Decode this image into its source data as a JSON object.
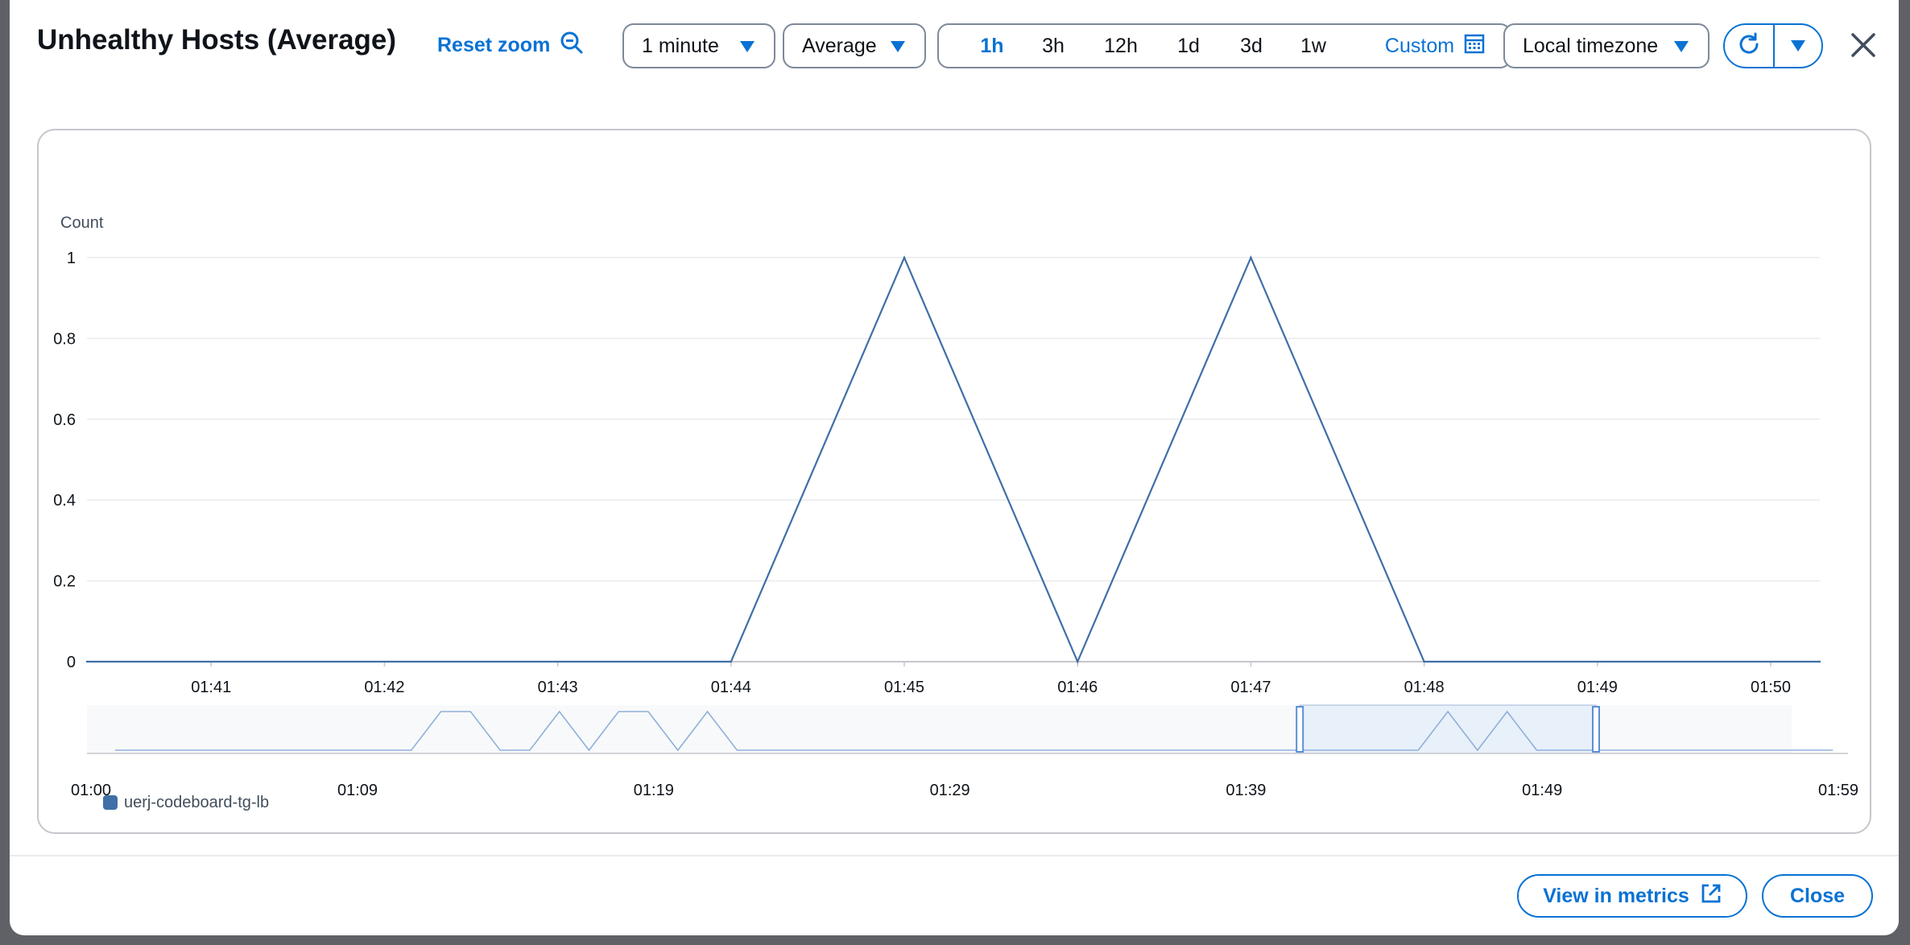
{
  "header": {
    "title": "Unhealthy Hosts (Average)",
    "reset_zoom_label": "Reset zoom",
    "period_value": "1 minute",
    "statistic_value": "Average",
    "time_ranges": [
      "1h",
      "3h",
      "12h",
      "1d",
      "3d",
      "1w"
    ],
    "active_range": "1h",
    "custom_label": "Custom",
    "timezone_value": "Local timezone"
  },
  "footer": {
    "view_in_metrics_label": "View in metrics",
    "close_label": "Close"
  },
  "colors": {
    "accent": "#0972d3",
    "series": "#3f6fa6",
    "navigator_fill": "#e8f0fa"
  },
  "chart_data": {
    "type": "line",
    "ylabel": "Count",
    "ylim": [
      0,
      1
    ],
    "yticks": [
      "0",
      "0.2",
      "0.4",
      "0.6",
      "0.8",
      "1"
    ],
    "xticks": [
      "01:41",
      "01:42",
      "01:43",
      "01:44",
      "01:45",
      "01:46",
      "01:47",
      "01:48",
      "01:49",
      "01:50"
    ],
    "x": [
      "01:40:17",
      "01:44",
      "01:45",
      "01:46",
      "01:47",
      "01:48",
      "01:50:17"
    ],
    "series": [
      {
        "name": "uerj-codeboard-tg-lb",
        "values": [
          0,
          0,
          1,
          0,
          1,
          0,
          0
        ]
      }
    ],
    "navigator": {
      "xticks": [
        "01:00",
        "01:09",
        "01:19",
        "01:29",
        "01:39",
        "01:49",
        "01:59"
      ],
      "x": [
        "01:00",
        "01:10",
        "01:11",
        "01:12",
        "01:13",
        "01:14",
        "01:15",
        "01:16",
        "01:17",
        "01:18",
        "01:19",
        "01:20",
        "01:21",
        "01:22",
        "01:44",
        "01:45",
        "01:46",
        "01:47",
        "01:48",
        "01:58"
      ],
      "values": [
        0,
        0,
        1,
        1,
        0,
        0,
        1,
        0,
        1,
        1,
        0,
        1,
        0,
        0,
        0,
        1,
        0,
        1,
        0,
        0
      ],
      "selection": [
        "01:40",
        "01:50"
      ]
    },
    "legend": {
      "placement": "bottom-left",
      "entries": [
        "uerj-codeboard-tg-lb"
      ]
    },
    "grid": true
  }
}
